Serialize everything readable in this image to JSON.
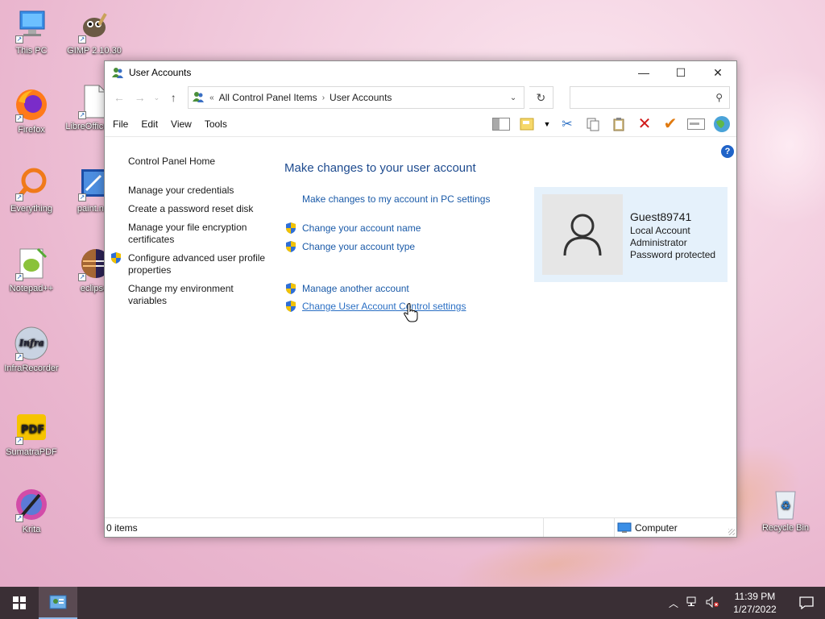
{
  "desktop": {
    "icons": [
      {
        "label": "This PC"
      },
      {
        "label": "GIMP 2.10.30"
      },
      {
        "label": "Firefox"
      },
      {
        "label": "LibreOffice 7.2"
      },
      {
        "label": "Everything"
      },
      {
        "label": "paint.net"
      },
      {
        "label": "Notepad++"
      },
      {
        "label": "eclipse"
      },
      {
        "label": "InfraRecorder"
      },
      {
        "label": "SumatraPDF"
      },
      {
        "label": "Krita"
      },
      {
        "label": "Recycle Bin"
      }
    ]
  },
  "window": {
    "title": "User Accounts",
    "controls": {
      "minimize": "—",
      "maximize": "☐",
      "close": "✕"
    },
    "address": {
      "chevron": "«",
      "crumbs": [
        "All Control Panel Items",
        "User Accounts"
      ]
    },
    "search": {
      "placeholder": ""
    },
    "menu": [
      "File",
      "Edit",
      "View",
      "Tools"
    ],
    "left_pane": {
      "home": "Control Panel Home",
      "links": [
        "Manage your credentials",
        "Create a password reset disk",
        "Manage your file encryption certificates",
        "Configure advanced user profile properties",
        "Change my environment variables"
      ]
    },
    "main": {
      "heading": "Make changes to your user account",
      "pc_settings_link": "Make changes to my account in PC settings",
      "links": [
        "Change your account name",
        "Change your account type",
        "Manage another account",
        "Change User Account Control settings"
      ]
    },
    "account": {
      "name": "Guest89741",
      "lines": [
        "Local Account",
        "Administrator",
        "Password protected"
      ]
    },
    "status": {
      "items": "0 items",
      "zone": "Computer"
    }
  },
  "taskbar": {
    "time": "11:39 PM",
    "date": "1/27/2022"
  },
  "colors": {
    "link": "#1a5aa8",
    "heading": "#1e4b8f",
    "taskbar": "#3a2f35",
    "card": "#e5f1fb"
  }
}
